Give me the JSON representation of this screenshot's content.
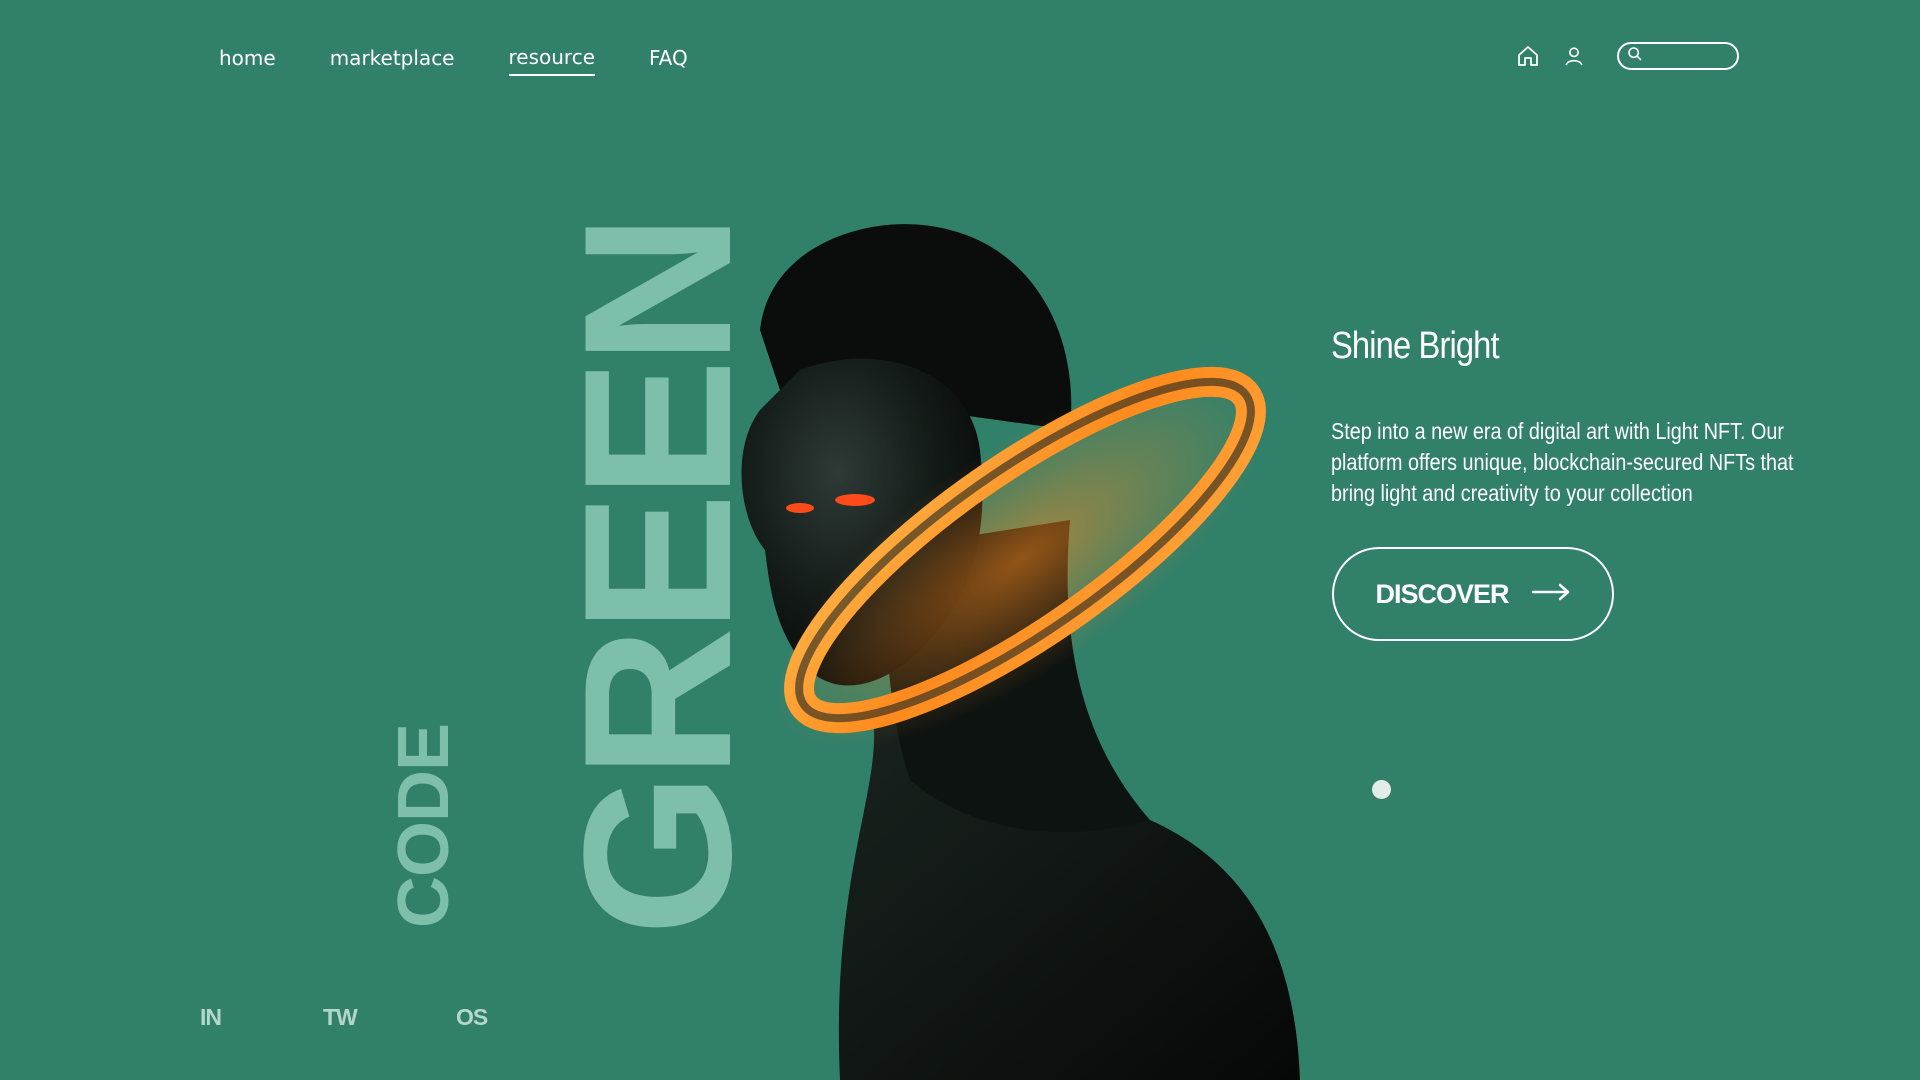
{
  "nav": {
    "links": [
      {
        "label": "home"
      },
      {
        "label": "marketplace"
      },
      {
        "label": "resource",
        "active": true
      },
      {
        "label": "FAQ"
      }
    ],
    "icons": [
      "home-icon",
      "user-icon"
    ],
    "search": {
      "placeholder": "",
      "icon": "search-icon"
    }
  },
  "wordmark": {
    "big": "GREEN",
    "small": "CODE"
  },
  "hero": {
    "title": "Shine Bright",
    "description": "Step into a new era of digital art with Light NFT. Our platform offers unique, blockchain-secured NFTs that bring light and creativity to your collection",
    "cta_label": "DISCOVER",
    "cta_icon": "arrow-right-icon"
  },
  "socials": [
    "IN",
    "TW",
    "OS"
  ],
  "colors": {
    "background": "#31806a",
    "wordmark": "#7ebfac",
    "ring": "#ff9a2e",
    "text": "#ffffff"
  }
}
